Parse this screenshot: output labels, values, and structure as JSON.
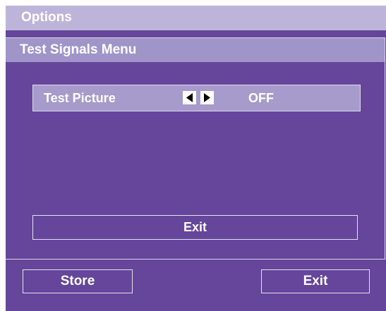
{
  "header": {
    "title": "Options"
  },
  "submenu": {
    "title": "Test Signals Menu",
    "test_picture": {
      "label": "Test Picture",
      "left_arrow_icon": "left-arrow-icon",
      "right_arrow_icon": "right-arrow-icon",
      "value": "OFF"
    },
    "exit_label": "Exit"
  },
  "footer": {
    "store_label": "Store",
    "exit_label": "Exit"
  },
  "colors": {
    "background": "#65469a",
    "header": "#bdb5d9",
    "subheader": "#9f95c9",
    "row_highlight": "#a69bcb",
    "text": "#ffffff"
  }
}
